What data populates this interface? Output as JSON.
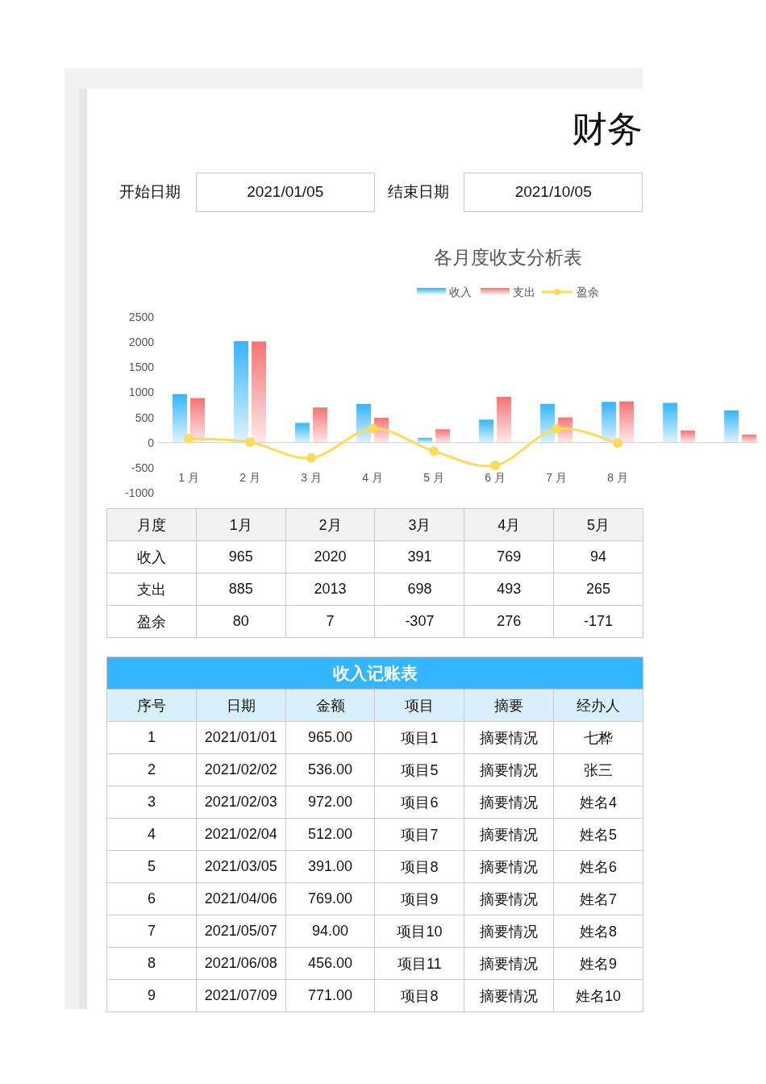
{
  "title": "财务",
  "date_range": {
    "start_label": "开始日期",
    "start_value": "2021/01/05",
    "end_label": "结束日期",
    "end_value": "2021/10/05"
  },
  "chart": {
    "chart_data": {
      "type": "bar",
      "title": "各月度收支分析表",
      "x": [
        1,
        2,
        3,
        4,
        5,
        6,
        7,
        8,
        9,
        10
      ],
      "xticks": [
        {
          "value": 1,
          "label": "1 月"
        },
        {
          "value": 2,
          "label": "2 月"
        },
        {
          "value": 3,
          "label": "3 月"
        },
        {
          "value": 4,
          "label": "4 月"
        },
        {
          "value": 5,
          "label": "5 月"
        },
        {
          "value": 6,
          "label": "6 月"
        },
        {
          "value": 7,
          "label": "7 月"
        },
        {
          "value": 8,
          "label": "8 月"
        }
      ],
      "series": [
        {
          "name": "收入",
          "color": "#33b5ff",
          "values": [
            965,
            2020,
            391,
            769,
            94,
            456,
            771,
            810,
            790,
            640
          ]
        },
        {
          "name": "支出",
          "color": "#f47374",
          "values": [
            885,
            2013,
            698,
            493,
            265,
            910,
            500,
            820,
            240,
            160
          ]
        },
        {
          "name": "盈余",
          "color": "#fadc5a",
          "type": "line",
          "marker": true,
          "values": [
            80,
            7,
            -307,
            276,
            -171,
            -454,
            271,
            -10,
            null,
            null
          ]
        }
      ],
      "xlim": [
        0.5,
        10.3
      ],
      "stacked": false,
      "legend": "top",
      "ylim": [
        -1000,
        2500
      ],
      "yticks": [
        -1000,
        -500,
        0,
        500,
        1000,
        1500,
        2000,
        2500
      ]
    }
  },
  "summary_table": {
    "columns": [
      "月度",
      "1月",
      "2月",
      "3月",
      "4月",
      "5月"
    ],
    "rows": [
      [
        "收入",
        "965",
        "2020",
        "391",
        "769",
        "94"
      ],
      [
        "支出",
        "885",
        "2013",
        "698",
        "493",
        "265"
      ],
      [
        "盈余",
        "80",
        "7",
        "-307",
        "276",
        "-171"
      ]
    ]
  },
  "income_table": {
    "title": "收入记账表",
    "columns": [
      "序号",
      "日期",
      "金额",
      "项目",
      "摘要",
      "经办人"
    ],
    "rows": [
      [
        "1",
        "2021/01/01",
        "965.00",
        "项目1",
        "摘要情况",
        "七桦"
      ],
      [
        "2",
        "2021/02/02",
        "536.00",
        "项目5",
        "摘要情况",
        "张三"
      ],
      [
        "3",
        "2021/02/03",
        "972.00",
        "项目6",
        "摘要情况",
        "姓名4"
      ],
      [
        "4",
        "2021/02/04",
        "512.00",
        "项目7",
        "摘要情况",
        "姓名5"
      ],
      [
        "5",
        "2021/03/05",
        "391.00",
        "项目8",
        "摘要情况",
        "姓名6"
      ],
      [
        "6",
        "2021/04/06",
        "769.00",
        "项目9",
        "摘要情况",
        "姓名7"
      ],
      [
        "7",
        "2021/05/07",
        "94.00",
        "项目10",
        "摘要情况",
        "姓名8"
      ],
      [
        "8",
        "2021/06/08",
        "456.00",
        "项目11",
        "摘要情况",
        "姓名9"
      ],
      [
        "9",
        "2021/07/09",
        "771.00",
        "项目8",
        "摘要情况",
        "姓名10"
      ]
    ]
  }
}
